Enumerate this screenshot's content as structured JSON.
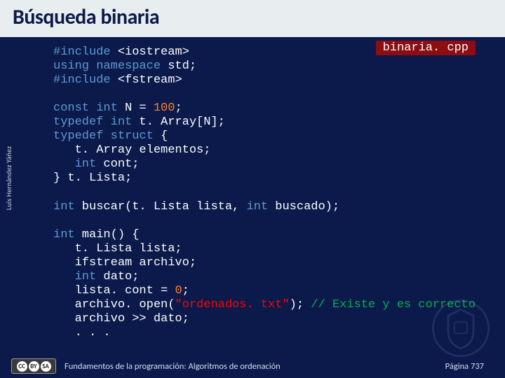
{
  "title": "Búsqueda binaria",
  "filename": "binaria. cpp",
  "code": {
    "l1_a": "#include",
    "l1_b": " <iostream>",
    "l2_a": "using namespace",
    "l2_b": " std;",
    "l3_a": "#include",
    "l3_b": " <fstream>",
    "l5_a": "const int",
    "l5_b": " N = ",
    "l5_c": "100",
    "l5_d": ";",
    "l6_a": "typedef int",
    "l6_b": " t. Array[N];",
    "l7_a": "typedef struct",
    "l7_b": " {",
    "l8": "   t. Array elementos;",
    "l9_a": "   ",
    "l9_b": "int",
    "l9_c": " cont;",
    "l10": "} t. Lista;",
    "l12_a": "int",
    "l12_b": " buscar(t. Lista lista, ",
    "l12_c": "int",
    "l12_d": " buscado);",
    "l14_a": "int",
    "l14_b": " main() {",
    "l15": "   t. Lista lista;",
    "l16": "   ifstream archivo;",
    "l17_a": "   ",
    "l17_b": "int",
    "l17_c": " dato;",
    "l18_a": "   lista. cont = ",
    "l18_b": "0",
    "l18_c": ";",
    "l19_a": "   archivo. open(",
    "l19_b": "\"ordenados. txt\"",
    "l19_c": "); ",
    "l19_d": "// Existe y es correcto",
    "l20": "   archivo >> dato;",
    "l21": "   . . ."
  },
  "author": "Luis Hernández Yáñez",
  "footer": "Fundamentos de la programación: Algoritmos de ordenación",
  "page": "Página 737",
  "cc": {
    "a": "CC",
    "b": "BY",
    "c": "SA"
  }
}
